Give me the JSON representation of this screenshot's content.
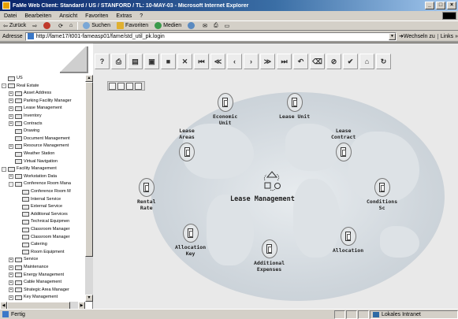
{
  "window": {
    "title": "FaMe Web Client: Standard / US / STANFORD / TL: 10-MAY-03 - Microsoft Internet Explorer",
    "controls": [
      "_",
      "□",
      "×"
    ]
  },
  "menu": [
    "Datei",
    "Bearbeiten",
    "Ansicht",
    "Favoriten",
    "Extras",
    "?"
  ],
  "ie_toolbar": {
    "back": "Zurück",
    "search": "Suchen",
    "favorites": "Favoriten",
    "media": "Medien"
  },
  "address": {
    "label": "Adresse",
    "url": "http://fame17/t001-fameasp01/fame/std_util_pk.login",
    "go": "Wechseln zu",
    "links": "Links »"
  },
  "tree": {
    "items": [
      {
        "label": "US",
        "level": 0,
        "expander": "",
        "folder": true
      },
      {
        "label": "Real Estate",
        "level": 0,
        "expander": "-",
        "folder": true
      },
      {
        "label": "Asset Address",
        "level": 1,
        "expander": "+",
        "folder": true
      },
      {
        "label": "Parking Facility Manager",
        "level": 1,
        "expander": "+",
        "folder": true
      },
      {
        "label": "Lease Management",
        "level": 1,
        "expander": "+",
        "folder": true
      },
      {
        "label": "Inventory",
        "level": 1,
        "expander": "+",
        "folder": true
      },
      {
        "label": "Contracts",
        "level": 1,
        "expander": "+",
        "folder": true
      },
      {
        "label": "Drawing",
        "level": 1,
        "expander": "",
        "folder": true
      },
      {
        "label": "Document Management",
        "level": 1,
        "expander": "",
        "folder": true
      },
      {
        "label": "Resource Management",
        "level": 1,
        "expander": "+",
        "folder": true
      },
      {
        "label": "Weather Station",
        "level": 1,
        "expander": "",
        "folder": true
      },
      {
        "label": "Virtual Navigation",
        "level": 1,
        "expander": "",
        "folder": true
      },
      {
        "label": "Facility Management",
        "level": 0,
        "expander": "-",
        "folder": true
      },
      {
        "label": "Workstation Data",
        "level": 1,
        "expander": "+",
        "folder": true
      },
      {
        "label": "Conference Room Mana",
        "level": 1,
        "expander": "-",
        "folder": true
      },
      {
        "label": "Conference Room M",
        "level": 2,
        "expander": "",
        "folder": true
      },
      {
        "label": "Internal Service",
        "level": 2,
        "expander": "",
        "folder": true
      },
      {
        "label": "External Service",
        "level": 2,
        "expander": "",
        "folder": true
      },
      {
        "label": "Additional Services",
        "level": 2,
        "expander": "",
        "folder": true
      },
      {
        "label": "Technical Equipmen",
        "level": 2,
        "expander": "",
        "folder": true
      },
      {
        "label": "Classroom Manager",
        "level": 2,
        "expander": "",
        "folder": true
      },
      {
        "label": "Classroom Manager",
        "level": 2,
        "expander": "",
        "folder": true
      },
      {
        "label": "Catering",
        "level": 2,
        "expander": "",
        "folder": true
      },
      {
        "label": "Room Equipment",
        "level": 2,
        "expander": "",
        "folder": true
      },
      {
        "label": "Service",
        "level": 1,
        "expander": "+",
        "folder": true
      },
      {
        "label": "Maintenance",
        "level": 1,
        "expander": "+",
        "folder": true
      },
      {
        "label": "Energy Management",
        "level": 1,
        "expander": "+",
        "folder": true
      },
      {
        "label": "Cable Management",
        "level": 1,
        "expander": "+",
        "folder": true
      },
      {
        "label": "Strategic Area Manager",
        "level": 1,
        "expander": "+",
        "folder": true
      },
      {
        "label": "Key Management",
        "level": 1,
        "expander": "+",
        "folder": true
      }
    ]
  },
  "app_toolbar": {
    "buttons": [
      {
        "icon": "help-icon",
        "glyph": "?"
      },
      {
        "icon": "print-icon",
        "glyph": "⎙"
      },
      {
        "icon": "print-preview-icon",
        "glyph": "▤"
      },
      {
        "icon": "save-as-icon",
        "glyph": "▣"
      },
      {
        "icon": "save-icon",
        "glyph": "■"
      },
      {
        "icon": "tools-icon",
        "glyph": "✕"
      },
      {
        "icon": "first-record-icon",
        "glyph": "⏮"
      },
      {
        "icon": "prev-page-icon",
        "glyph": "≪"
      },
      {
        "icon": "prev-record-icon",
        "glyph": "‹"
      },
      {
        "icon": "next-record-icon",
        "glyph": "›"
      },
      {
        "icon": "next-page-icon",
        "glyph": "≫"
      },
      {
        "icon": "last-record-icon",
        "glyph": "⏭"
      },
      {
        "icon": "undo-icon",
        "glyph": "↶"
      },
      {
        "icon": "erase-icon",
        "glyph": "⌫"
      },
      {
        "icon": "stop-icon",
        "glyph": "⊘"
      },
      {
        "icon": "check-icon",
        "glyph": "✔"
      },
      {
        "icon": "home-icon",
        "glyph": "⌂"
      },
      {
        "icon": "refresh-icon",
        "glyph": "↻"
      }
    ]
  },
  "diagram": {
    "center_title": "Lease Management",
    "nodes": [
      {
        "id": "economic-unit",
        "label": "Economic\nUnit"
      },
      {
        "id": "lease-unit",
        "label": "Lease Unit"
      },
      {
        "id": "lease-areas",
        "label": "Lease\nAreas"
      },
      {
        "id": "lease-contract",
        "label": "Lease\nContract"
      },
      {
        "id": "rental-rate",
        "label": "Rental\nRate"
      },
      {
        "id": "conditions",
        "label": "Conditions\nSc"
      },
      {
        "id": "allocation-key",
        "label": "Allocation\nKey"
      },
      {
        "id": "allocation",
        "label": "Allocation"
      },
      {
        "id": "additional-expenses",
        "label": "Additional\nExpenses"
      }
    ]
  },
  "status": {
    "text": "Fertig",
    "zone": "Lokales Intranet"
  },
  "colors": {
    "title_bar_start": "#0a246a",
    "title_bar_end": "#a6caf0",
    "content_bg": "#e9e9e9",
    "world_bg": "#cfd6dc"
  }
}
